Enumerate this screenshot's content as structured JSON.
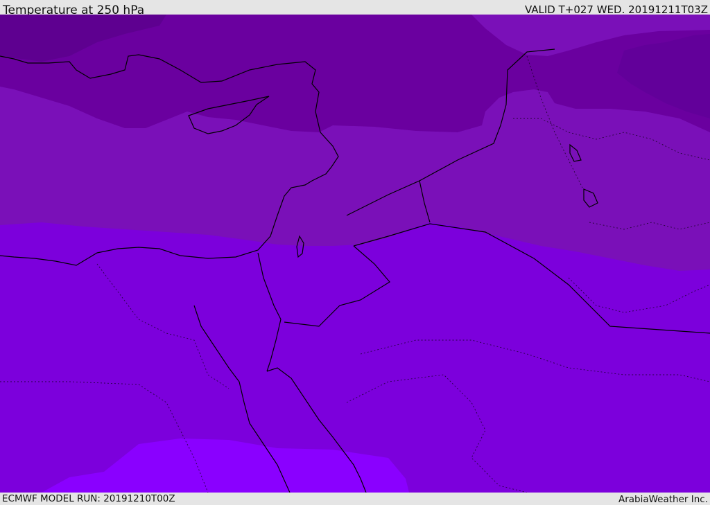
{
  "header": {
    "title": "Temperature at 250 hPa",
    "valid_time": "VALID T+027 WED. 20191211T03Z"
  },
  "footer": {
    "model_run": "ECMWF MODEL RUN: 20191210T00Z",
    "credit": "ArabiaWeather Inc."
  },
  "map": {
    "field": "temperature",
    "level": "250 hPa",
    "palette": {
      "band_coldest": "#5e0090",
      "band_cold": "#6a009f",
      "band_mid": "#7a10b8",
      "band_warm": "#7c00dc",
      "band_warmest": "#8a00ff",
      "coastline": "#000000"
    }
  }
}
